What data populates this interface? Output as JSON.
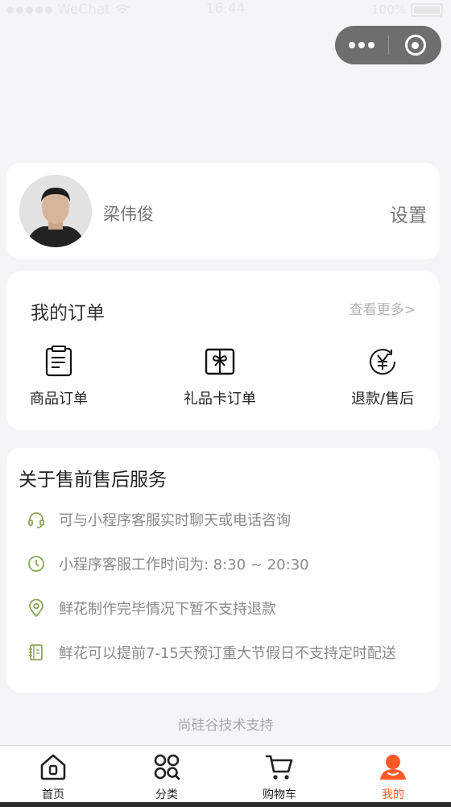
{
  "status_bar": {
    "carrier": "WeChat",
    "time": "16:44",
    "battery": "100%"
  },
  "profile": {
    "name": "梁伟俊",
    "settings_label": "设置"
  },
  "orders": {
    "title": "我的订单",
    "more_label": "查看更多>",
    "items": [
      {
        "label": "商品订单",
        "icon": "list-doc-icon"
      },
      {
        "label": "礼品卡订单",
        "icon": "gift-card-icon"
      },
      {
        "label": "退款/售后",
        "icon": "yuan-refund-icon"
      }
    ]
  },
  "service": {
    "title": "关于售前售后服务",
    "items": [
      {
        "text": "可与小程序客服实时聊天或电话咨询",
        "icon": "headset-icon"
      },
      {
        "text": "小程序客服工作时间为: 8:30 ~ 20:30",
        "icon": "clock-icon"
      },
      {
        "text": "鲜花制作完毕情况下暂不支持退款",
        "icon": "location-pin-icon"
      },
      {
        "text": "鲜花可以提前7-15天预订重大节假日不支持定时配送",
        "icon": "notebook-icon"
      }
    ],
    "icon_color": "#8aa55b"
  },
  "support_text": "尚硅谷技术支持",
  "tabbar": {
    "items": [
      {
        "label": "首页",
        "icon": "home-icon"
      },
      {
        "label": "分类",
        "icon": "category-icon"
      },
      {
        "label": "购物车",
        "icon": "cart-icon"
      },
      {
        "label": "我的",
        "icon": "user-icon"
      }
    ],
    "active_index": 3,
    "active_color": "#ff5a25"
  }
}
